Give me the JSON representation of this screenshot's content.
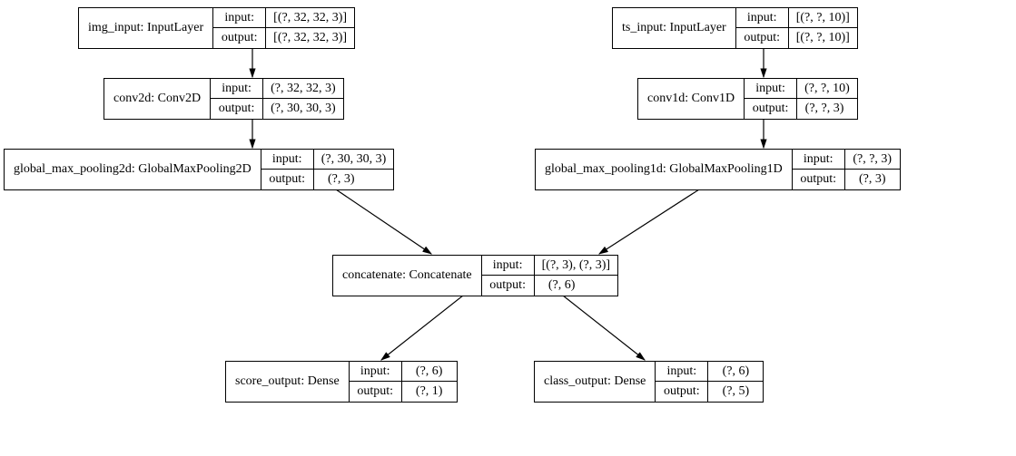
{
  "labels": {
    "input": "input:",
    "output": "output:"
  },
  "nodes": {
    "img_input": {
      "name": "img_input: InputLayer",
      "input": "[(?, 32, 32, 3)]",
      "output": "[(?, 32, 32, 3)]"
    },
    "ts_input": {
      "name": "ts_input: InputLayer",
      "input": "[(?, ?, 10)]",
      "output": "[(?, ?, 10)]"
    },
    "conv2d": {
      "name": "conv2d: Conv2D",
      "input": "(?, 32, 32, 3)",
      "output": "(?, 30, 30, 3)"
    },
    "conv1d": {
      "name": "conv1d: Conv1D",
      "input": "(?, ?, 10)",
      "output": "(?, ?, 3)"
    },
    "gmp2d": {
      "name": "global_max_pooling2d: GlobalMaxPooling2D",
      "input": "(?, 30, 30, 3)",
      "output": "(?, 3)"
    },
    "gmp1d": {
      "name": "global_max_pooling1d: GlobalMaxPooling1D",
      "input": "(?, ?, 3)",
      "output": "(?, 3)"
    },
    "concat": {
      "name": "concatenate: Concatenate",
      "input": "[(?, 3), (?, 3)]",
      "output": "(?, 6)"
    },
    "score": {
      "name": "score_output: Dense",
      "input": "(?, 6)",
      "output": "(?, 1)"
    },
    "class": {
      "name": "class_output: Dense",
      "input": "(?, 6)",
      "output": "(?, 5)"
    }
  }
}
